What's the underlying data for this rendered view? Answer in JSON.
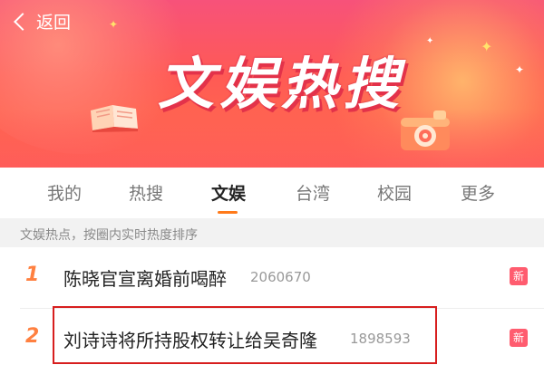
{
  "header": {
    "back_label": "返回",
    "banner_title": "文娱热搜"
  },
  "tabs": [
    {
      "label": "我的",
      "active": false
    },
    {
      "label": "热搜",
      "active": false
    },
    {
      "label": "文娱",
      "active": true
    },
    {
      "label": "台湾",
      "active": false
    },
    {
      "label": "校园",
      "active": false
    },
    {
      "label": "更多",
      "active": false
    }
  ],
  "subheader": "文娱热点，按圈内实时热度排序",
  "list": [
    {
      "rank": "1",
      "title": "陈晓官宣离婚前喝醉",
      "heat": "2060670",
      "badge": "新"
    },
    {
      "rank": "2",
      "title": "刘诗诗将所持股权转让给吴奇隆",
      "heat": "1898593",
      "badge": "新"
    }
  ],
  "colors": {
    "banner_top": "#f7527a",
    "banner_bottom": "#ff6f4a",
    "rank_color": "#ff8040",
    "tab_underline": "#ff7a1a",
    "badge": "#ff5c6f",
    "highlight_box": "#d71e1e"
  },
  "icons": {
    "back": "chevron-left-icon",
    "banner_book": "open-book-icon",
    "banner_camera": "camera-icon",
    "banner_sparkle": "sparkle-icon"
  }
}
